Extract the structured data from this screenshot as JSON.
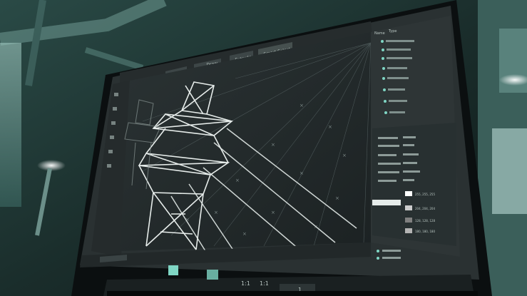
{
  "colors": {
    "room_dark": "#0f1a19",
    "room_teal": "#4f8a82",
    "monitor_bezel": "#0b0f10",
    "app_bg": "#2a3132",
    "viewport_bg": "#1f2526",
    "panel_bg": "#2e3536",
    "accent": "#7fd6c4",
    "wire": "#cfd6d4",
    "tower": "#e6ecea"
  },
  "toolbar": {
    "buttons": [
      "Draw",
      "Extrude",
      "Smart Select"
    ]
  },
  "outliner": {
    "header": [
      "Name",
      "Type"
    ]
  },
  "properties": {
    "color_values": [
      "255, 255, 255",
      "204, 204, 204",
      "128, 128, 128",
      "180, 180, 180"
    ]
  },
  "statusbar": {
    "zoom_a": "1:1",
    "zoom_b": "1:1",
    "page": "1"
  },
  "icons": [
    "monitor",
    "transmission-tower",
    "grid",
    "window",
    "ceiling-pipe",
    "light"
  ]
}
